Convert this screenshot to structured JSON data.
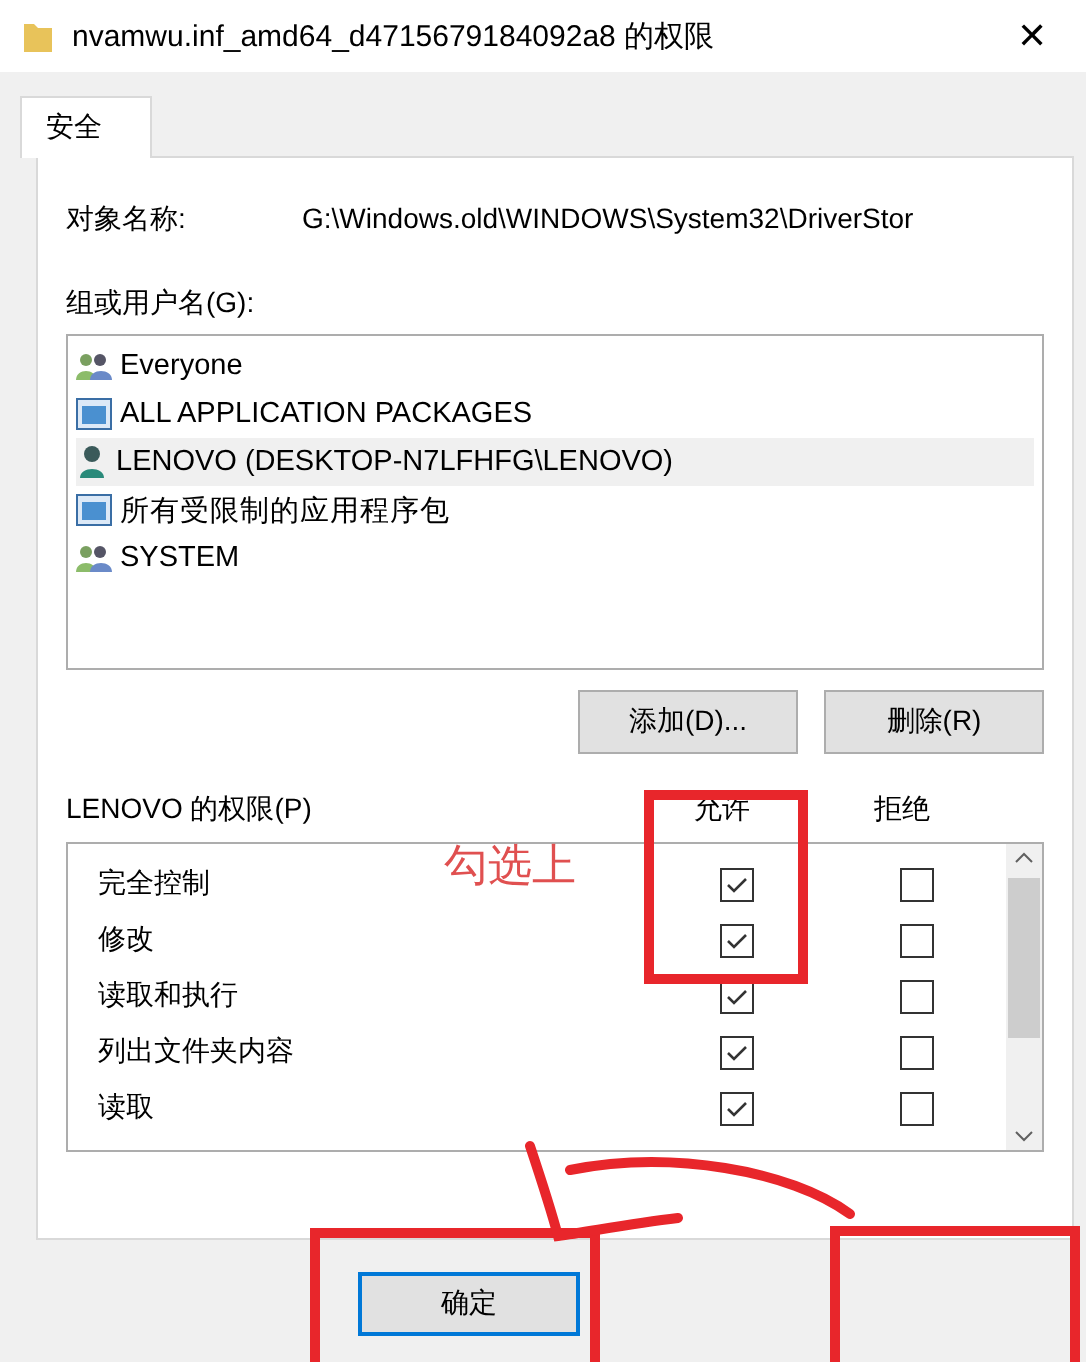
{
  "window": {
    "title": "nvamwu.inf_amd64_d4715679184092a8 的权限",
    "close": "✕"
  },
  "tabs": [
    {
      "label": "安全",
      "selected": true
    }
  ],
  "object_name": {
    "label": "对象名称:",
    "value": "G:\\Windows.old\\WINDOWS\\System32\\DriverStor"
  },
  "groups": {
    "label": "组或用户名(G):",
    "items": [
      {
        "name": "Everyone",
        "kind": "group",
        "selected": false
      },
      {
        "name": "ALL APPLICATION PACKAGES",
        "kind": "package",
        "selected": false
      },
      {
        "name": "LENOVO (DESKTOP-N7LFHFG\\LENOVO)",
        "kind": "user",
        "selected": true
      },
      {
        "name": "所有受限制的应用程序包",
        "kind": "package",
        "selected": false
      },
      {
        "name": "SYSTEM",
        "kind": "group",
        "selected": false
      }
    ]
  },
  "group_buttons": [
    "添加(D)...",
    "删除(R)"
  ],
  "permissions": {
    "label": "LENOVO 的权限(P)",
    "allow_header": "允许",
    "deny_header": "拒绝",
    "rows": [
      {
        "name": "完全控制",
        "allow": true,
        "deny": false
      },
      {
        "name": "修改",
        "allow": true,
        "deny": false
      },
      {
        "name": "读取和执行",
        "allow": true,
        "deny": false
      },
      {
        "name": "列出文件夹内容",
        "allow": true,
        "deny": false
      },
      {
        "name": "读取",
        "allow": true,
        "deny": false
      }
    ]
  },
  "annotation": {
    "text": "勾选上"
  },
  "footer_buttons": [
    "确定"
  ]
}
